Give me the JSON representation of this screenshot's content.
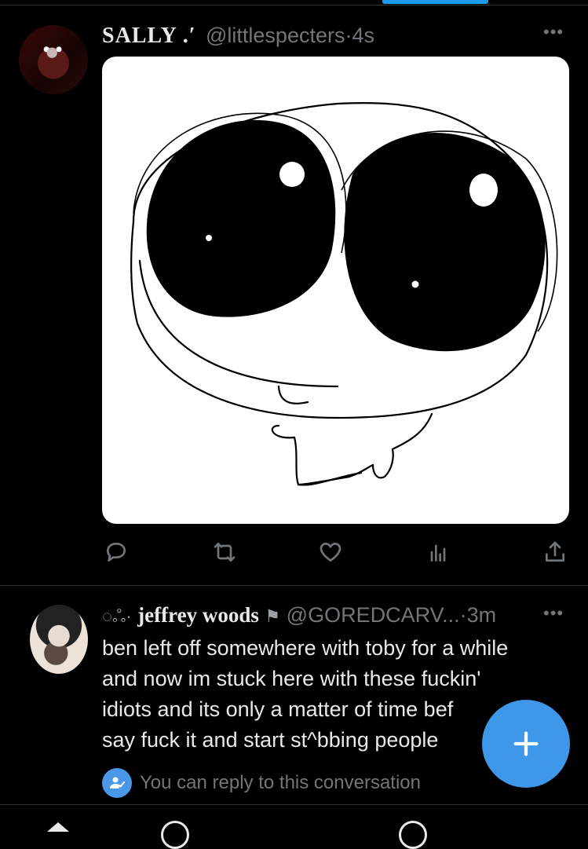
{
  "post": {
    "author_name": "SALLY .′",
    "handle_time": "@littlespecters·4s",
    "more_label": "•••",
    "media_icon": "doodle-image",
    "actions": [
      "reply-icon",
      "retweet-icon",
      "like-icon",
      "views-icon",
      "share-icon"
    ]
  },
  "reply": {
    "prefix": "◌ஃ·",
    "author_name": "jeffrey woods",
    "author_suffix": "⚑",
    "handle_time": "@GOREDCARV...·3m",
    "more_label": "•••",
    "text_lines": [
      "ben left off somewhere with toby for a while",
      "and now im stuck here with these fuckin'",
      "idiots and its only a matter of time bef",
      "say fuck it and start st^bbing people"
    ]
  },
  "reply_notice": {
    "text": "You can reply to this conversation"
  },
  "compose": {
    "icon": "plus-icon"
  },
  "colors": {
    "background": "#000000",
    "accent": "#1d9bf0",
    "fab": "#3f97ea",
    "muted": "#71767b",
    "text": "#e7e9ea"
  }
}
